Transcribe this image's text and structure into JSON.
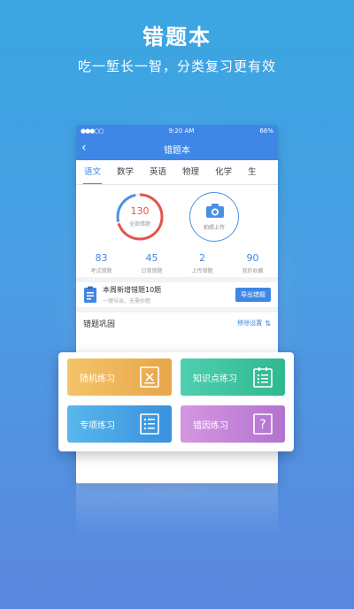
{
  "hero": {
    "title": "错题本",
    "subtitle": "吃一堑长一智，分类复习更有效"
  },
  "statusbar": {
    "signal": "●●●○○",
    "wifi": "wifi-icon",
    "time": "9:20 AM",
    "battery": "66%"
  },
  "navbar": {
    "back": "‹",
    "title": "错题本"
  },
  "tabs": [
    {
      "label": "语文",
      "active": true
    },
    {
      "label": "数学"
    },
    {
      "label": "英语"
    },
    {
      "label": "物理"
    },
    {
      "label": "化学"
    },
    {
      "label": "生"
    }
  ],
  "summary": {
    "total_count": "130",
    "total_label": "全部错题",
    "upload_label": "拍照上传"
  },
  "stats": [
    {
      "value": "83",
      "label": "考试错题"
    },
    {
      "value": "45",
      "label": "日常错题"
    },
    {
      "value": "2",
      "label": "上传错题"
    },
    {
      "value": "90",
      "label": "我的收藏"
    }
  ],
  "weekly": {
    "title": "本周新增错题10题",
    "subtitle": "一键导出，无需抄题",
    "export_label": "导出错题"
  },
  "practice": {
    "title": "错题巩固",
    "remove_label": "移除设置",
    "sort_icon": "⇅",
    "cards": [
      {
        "label": "随机练习",
        "icon": "random-icon"
      },
      {
        "label": "知识点练习",
        "icon": "checklist-icon"
      },
      {
        "label": "专项练习",
        "icon": "list-icon"
      },
      {
        "label": "错因练习",
        "icon": "question-icon"
      }
    ]
  },
  "colors": {
    "primary": "#3f87e6",
    "ring_red": "#e2544c"
  }
}
